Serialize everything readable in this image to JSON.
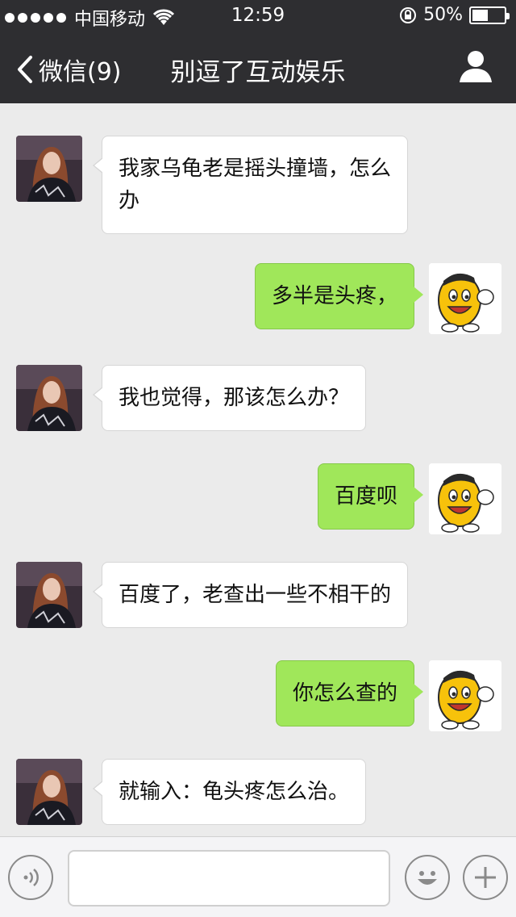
{
  "status_bar": {
    "carrier": "中国移动",
    "time": "12:59",
    "battery_percent_label": "50%",
    "battery_level": 0.5
  },
  "nav": {
    "back_label": "微信(9)",
    "title": "别逗了互动娱乐"
  },
  "messages": [
    {
      "side": "in",
      "text_lines": [
        "我家乌龟老是摇头撞墙，怎么",
        "办"
      ]
    },
    {
      "side": "out",
      "text_lines": [
        "多半是头疼，"
      ]
    },
    {
      "side": "in",
      "text_lines": [
        "我也觉得，那该怎么办？"
      ]
    },
    {
      "side": "out",
      "text_lines": [
        "百度呗"
      ]
    },
    {
      "side": "in",
      "text_lines": [
        "百度了，老查出一些不相干的"
      ]
    },
    {
      "side": "out",
      "text_lines": [
        "你怎么查的"
      ]
    },
    {
      "side": "in",
      "text_lines": [
        "就输入：龟头疼怎么治。"
      ]
    }
  ],
  "input": {
    "value": "",
    "placeholder": ""
  },
  "colors": {
    "header_bg": "#2e2e31",
    "chat_bg": "#ebebeb",
    "bubble_out": "#a0e75a",
    "bubble_in": "#ffffff"
  },
  "icons": {
    "back": "chevron-left-icon",
    "profile": "person-icon",
    "voice": "voice-icon",
    "emoji": "emoji-icon",
    "plus": "plus-icon"
  }
}
